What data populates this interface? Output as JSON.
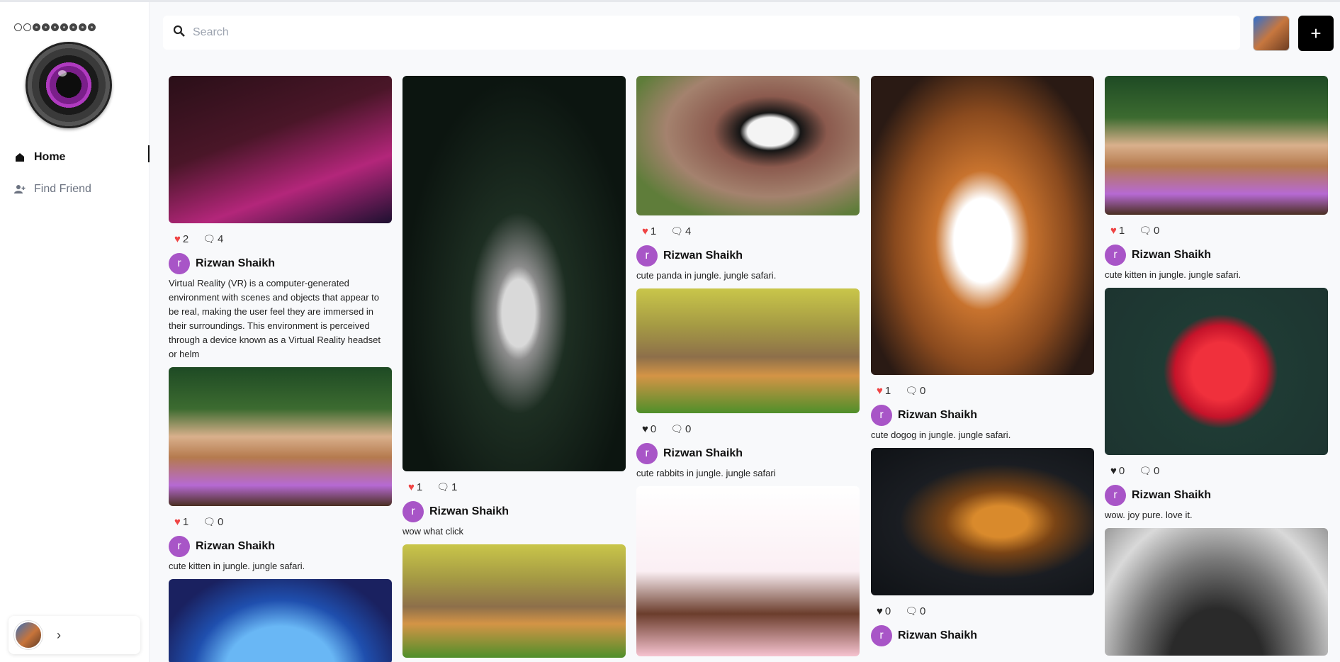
{
  "sidebar": {
    "nav": [
      {
        "label": "Home",
        "icon": "home-icon",
        "active": true
      },
      {
        "label": "Find Friend",
        "icon": "add-user-icon",
        "active": false
      }
    ],
    "user_chevron": "›"
  },
  "header": {
    "search_placeholder": "Search",
    "add_label": "+"
  },
  "posts": {
    "c1": [
      {
        "likes": "2",
        "liked": true,
        "comments": "4",
        "author": "Rizwan Shaikh",
        "initial": "r",
        "caption": "Virtual Reality (VR) is a computer-generated environment with scenes and objects that appear to be real, making the user feel they are immersed in their surroundings. This environment is perceived through a device known as a Virtual Reality headset or helm",
        "image": "vr-headset-photo"
      },
      {
        "likes": "1",
        "liked": true,
        "comments": "0",
        "author": "Rizwan Shaikh",
        "initial": "r",
        "caption": "cute kitten in jungle. jungle safari.",
        "image": "kittens-photo"
      },
      {
        "image": "blue-cat-3d-photo"
      }
    ],
    "c2": [
      {
        "likes": "1",
        "liked": true,
        "comments": "1",
        "author": "Rizwan Shaikh",
        "initial": "r",
        "caption": "wow what click",
        "image": "white-tiger-photo"
      },
      {
        "image": "rabbits-photo"
      }
    ],
    "c3": [
      {
        "likes": "1",
        "liked": true,
        "comments": "4",
        "author": "Rizwan Shaikh",
        "initial": "r",
        "caption": "cute panda in jungle. jungle safari.",
        "image": "panda-photo"
      },
      {
        "likes": "0",
        "liked": false,
        "comments": "0",
        "author": "Rizwan Shaikh",
        "initial": "r",
        "caption": "cute rabbits in jungle. jungle safari",
        "image": "rabbits-photo"
      },
      {
        "image": "girl-illustration"
      }
    ],
    "c4": [
      {
        "likes": "1",
        "liked": true,
        "comments": "0",
        "author": "Rizwan Shaikh",
        "initial": "r",
        "caption": "cute dogog in jungle. jungle safari.",
        "image": "puppy-photo"
      },
      {
        "likes": "0",
        "liked": false,
        "comments": "0",
        "author": "Rizwan Shaikh",
        "initial": "r",
        "image": "leopard-photo"
      }
    ],
    "c5": [
      {
        "likes": "1",
        "liked": true,
        "comments": "0",
        "author": "Rizwan Shaikh",
        "initial": "r",
        "caption": "cute kitten in jungle. jungle safari.",
        "image": "kittens-photo"
      },
      {
        "likes": "0",
        "liked": false,
        "comments": "0",
        "author": "Rizwan Shaikh",
        "initial": "r",
        "caption": "wow. joy pure. love it.",
        "image": "red-dahlia-photo"
      },
      {
        "image": "ferris-wheel-photo"
      }
    ]
  },
  "colors": {
    "like_active": "#ef4444",
    "avatar": "#a855c7",
    "add_button": "#000000"
  }
}
